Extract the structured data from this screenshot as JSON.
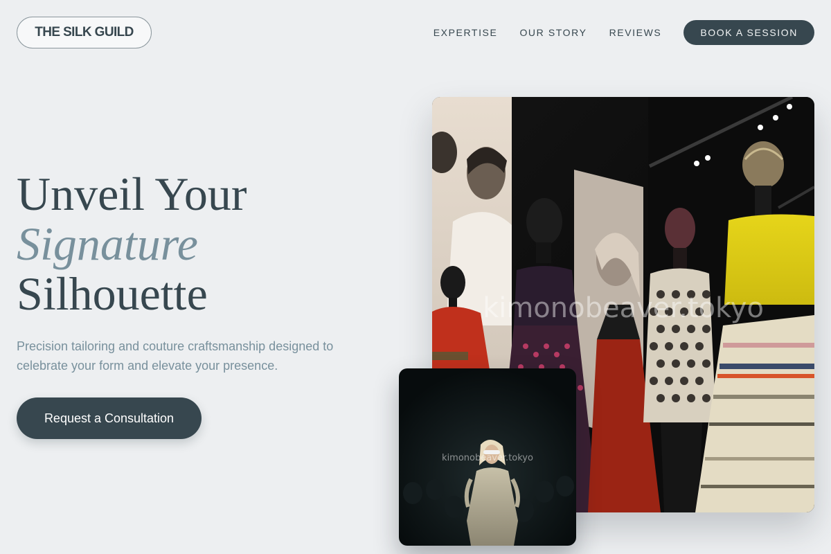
{
  "header": {
    "logo": "THE SILK GUILD",
    "nav": [
      {
        "label": "EXPERTISE"
      },
      {
        "label": "OUR STORY"
      },
      {
        "label": "REVIEWS"
      }
    ],
    "cta_label": "BOOK A SESSION"
  },
  "hero": {
    "headline_line1": "Unveil Your",
    "headline_accent": "Signature",
    "headline_line3": "Silhouette",
    "subcopy": "Precision tailoring and couture craftsmanship designed to celebrate your form and elevate your presence.",
    "cta_label": "Request a Consultation"
  },
  "images": {
    "main_watermark": "kimonobeaver.tokyo",
    "inset_watermark": "kimonobeaver.tokyo"
  },
  "colors": {
    "background": "#edeff1",
    "primary": "#37474f",
    "accent": "#78909c"
  }
}
